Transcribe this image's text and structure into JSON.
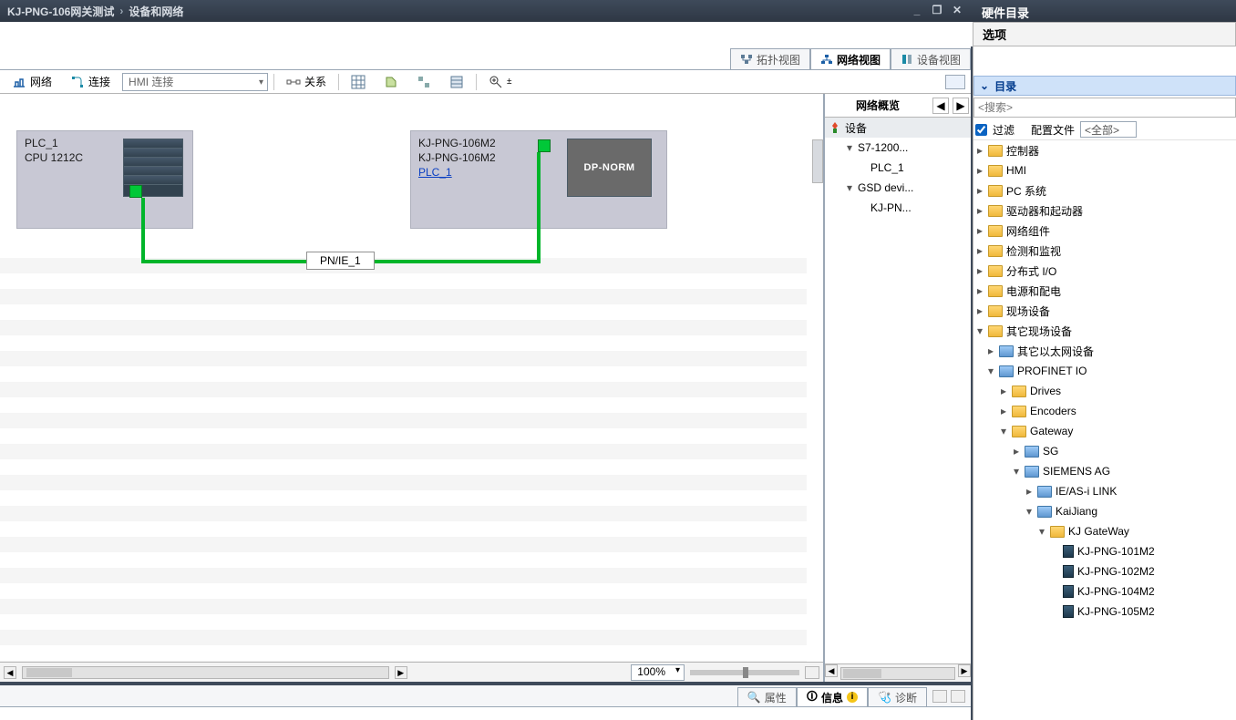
{
  "title": {
    "project": "KJ-PNG-106网关测试",
    "page": "设备和网络"
  },
  "win": {
    "min": "_",
    "restore": "❐",
    "close": "✕"
  },
  "side_titles": {
    "hw_catalog": "硬件目录",
    "options": "选项"
  },
  "view_tabs": {
    "topology": "拓扑视图",
    "network": "网络视图",
    "device": "设备视图"
  },
  "toolbar": {
    "network": "网络",
    "connect": "连接",
    "conn_type": "HMI 连接",
    "relation": "关系"
  },
  "devices": {
    "plc": {
      "name": "PLC_1",
      "type": "CPU 1212C"
    },
    "kj": {
      "name": "KJ-PNG-106M2",
      "type": "KJ-PNG-106M2",
      "link": "PLC_1",
      "badge": "DP-NORM"
    },
    "net": "PN/IE_1"
  },
  "zoom": "100%",
  "overview": {
    "title": "网络概览",
    "head": "设备",
    "rows": [
      {
        "indent": 1,
        "arrow": "▾",
        "label": "S7-1200..."
      },
      {
        "indent": 2,
        "arrow": "",
        "label": "PLC_1"
      },
      {
        "indent": 1,
        "arrow": "▾",
        "label": "GSD devi..."
      },
      {
        "indent": 2,
        "arrow": "",
        "label": "KJ-PN..."
      }
    ]
  },
  "lower_tabs": {
    "props": "属性",
    "info": "信息",
    "diag": "诊断"
  },
  "catalog": {
    "section": "目录",
    "search_ph": "<搜索>",
    "filter": "过滤",
    "profile_lbl": "配置文件",
    "profile_val": "<全部>",
    "nodes": [
      {
        "ind": 0,
        "arrow": "▸",
        "icon": "fold",
        "label": "控制器"
      },
      {
        "ind": 0,
        "arrow": "▸",
        "icon": "fold",
        "label": "HMI"
      },
      {
        "ind": 0,
        "arrow": "▸",
        "icon": "fold",
        "label": "PC 系统"
      },
      {
        "ind": 0,
        "arrow": "▸",
        "icon": "fold",
        "label": "驱动器和起动器"
      },
      {
        "ind": 0,
        "arrow": "▸",
        "icon": "fold",
        "label": "网络组件"
      },
      {
        "ind": 0,
        "arrow": "▸",
        "icon": "fold",
        "label": "检测和监视"
      },
      {
        "ind": 0,
        "arrow": "▸",
        "icon": "fold",
        "label": "分布式 I/O"
      },
      {
        "ind": 0,
        "arrow": "▸",
        "icon": "fold",
        "label": "电源和配电"
      },
      {
        "ind": 0,
        "arrow": "▸",
        "icon": "fold",
        "label": "现场设备"
      },
      {
        "ind": 0,
        "arrow": "▾",
        "icon": "fold",
        "label": "其它现场设备"
      },
      {
        "ind": 1,
        "arrow": "▸",
        "icon": "foldb",
        "label": "其它以太网设备"
      },
      {
        "ind": 1,
        "arrow": "▾",
        "icon": "foldb",
        "label": "PROFINET IO"
      },
      {
        "ind": 2,
        "arrow": "▸",
        "icon": "fold",
        "label": "Drives"
      },
      {
        "ind": 2,
        "arrow": "▸",
        "icon": "fold",
        "label": "Encoders"
      },
      {
        "ind": 2,
        "arrow": "▾",
        "icon": "fold",
        "label": "Gateway"
      },
      {
        "ind": 3,
        "arrow": "▸",
        "icon": "foldb",
        "label": "SG"
      },
      {
        "ind": 3,
        "arrow": "▾",
        "icon": "foldb",
        "label": "SIEMENS AG"
      },
      {
        "ind": 4,
        "arrow": "▸",
        "icon": "foldb",
        "label": "IE/AS-i LINK"
      },
      {
        "ind": 4,
        "arrow": "▾",
        "icon": "foldb",
        "label": "KaiJiang"
      },
      {
        "ind": 5,
        "arrow": "▾",
        "icon": "fold",
        "label": "KJ GateWay"
      },
      {
        "ind": 6,
        "arrow": "",
        "icon": "dev",
        "label": "KJ-PNG-101M2"
      },
      {
        "ind": 6,
        "arrow": "",
        "icon": "dev",
        "label": "KJ-PNG-102M2"
      },
      {
        "ind": 6,
        "arrow": "",
        "icon": "dev",
        "label": "KJ-PNG-104M2"
      },
      {
        "ind": 6,
        "arrow": "",
        "icon": "dev",
        "label": "KJ-PNG-105M2"
      }
    ]
  }
}
